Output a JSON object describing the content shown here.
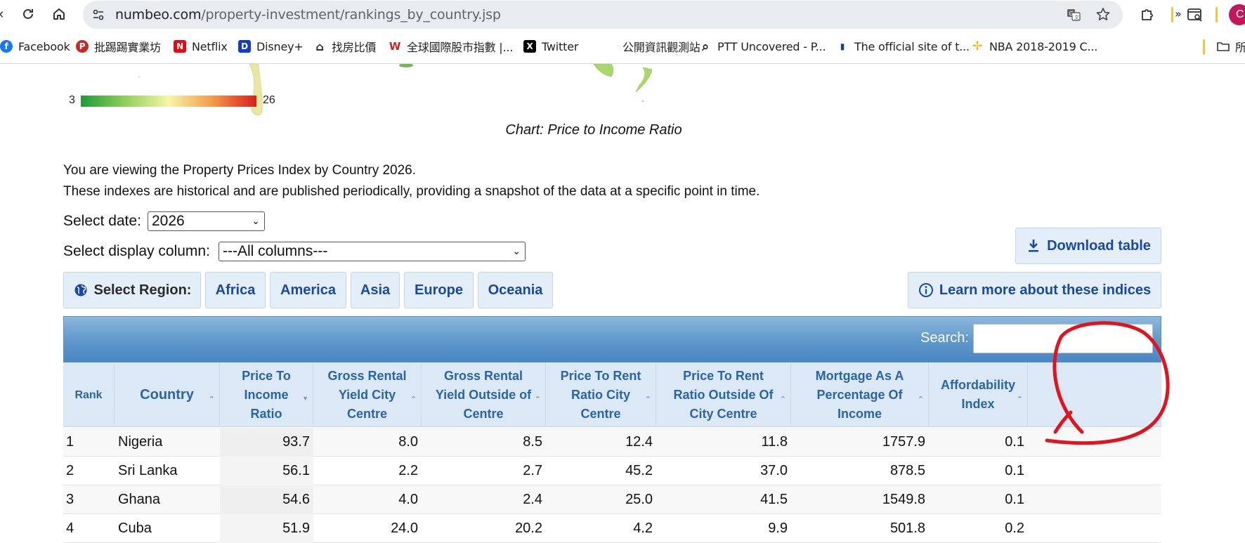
{
  "browser": {
    "url_host": "numbeo.com",
    "url_path": "/property-investment/rankings_by_country.jsp",
    "profile_initial": "C",
    "bookmarks": [
      {
        "label": "Facebook",
        "icon": "facebook-icon",
        "color": "#1877f2"
      },
      {
        "label": "批踢踢實業坊",
        "icon": "ptt-icon",
        "color": "#c62828"
      },
      {
        "label": "Netflix",
        "icon": "netflix-icon",
        "color": "#e50914"
      },
      {
        "label": "Disney+",
        "icon": "disney-icon",
        "color": "#113ccf"
      },
      {
        "label": "找房比價",
        "icon": "house-icon",
        "color": "#2e7d32"
      },
      {
        "label": "全球國際股市指數 |...",
        "icon": "w-icon",
        "color": "#c62828"
      },
      {
        "label": "Twitter",
        "icon": "x-icon",
        "color": "#000000"
      },
      {
        "label": "公開資訊觀測站",
        "icon": "blank-icon",
        "color": "#ffffff"
      },
      {
        "label": "PTT Uncovered - P...",
        "icon": "magnifier-icon",
        "color": "#000000"
      },
      {
        "label": "The official site of t...",
        "icon": "nba-icon",
        "color": "#1d428a"
      },
      {
        "label": "NBA 2018-2019 C...",
        "icon": "pinwheel-icon",
        "color": "#f4b400"
      }
    ],
    "more_bookmarks": "»",
    "folder_label": "所"
  },
  "legend": {
    "min": "3",
    "max": "26"
  },
  "chart_caption": "Chart: Price to Income Ratio",
  "intro": {
    "line1": "You are viewing the Property Prices Index by Country 2026.",
    "line2": "These indexes are historical and are published periodically, providing a snapshot of the data at a specific point in time."
  },
  "controls": {
    "date_label": "Select date:",
    "date_value": "2026",
    "column_label": "Select display column:",
    "column_value": "---All columns---",
    "download_label": "Download table",
    "region_label": "Select Region:",
    "regions": [
      "Africa",
      "America",
      "Asia",
      "Europe",
      "Oceania"
    ],
    "learn_more_label": "Learn more about these indices"
  },
  "table": {
    "search_label": "Search:",
    "columns": [
      "Rank",
      "Country",
      "Price To Income Ratio",
      "Gross Rental Yield City Centre",
      "Gross Rental Yield Outside of Centre",
      "Price To Rent Ratio City Centre",
      "Price To Rent Ratio Outside Of City Centre",
      "Mortgage As A Percentage Of Income",
      "Affordability Index"
    ],
    "rows": [
      [
        "1",
        "Nigeria",
        "93.7",
        "8.0",
        "8.5",
        "12.4",
        "11.8",
        "1757.9",
        "0.1"
      ],
      [
        "2",
        "Sri Lanka",
        "56.1",
        "2.2",
        "2.7",
        "45.2",
        "37.0",
        "878.5",
        "0.1"
      ],
      [
        "3",
        "Ghana",
        "54.6",
        "4.0",
        "2.4",
        "25.0",
        "41.5",
        "1549.8",
        "0.1"
      ],
      [
        "4",
        "Cuba",
        "51.9",
        "24.0",
        "20.2",
        "4.2",
        "9.9",
        "501.8",
        "0.2"
      ]
    ]
  },
  "colors": {
    "accent": "#1948a6",
    "header_text": "#2b63ab",
    "annotation": "#e0141e"
  }
}
